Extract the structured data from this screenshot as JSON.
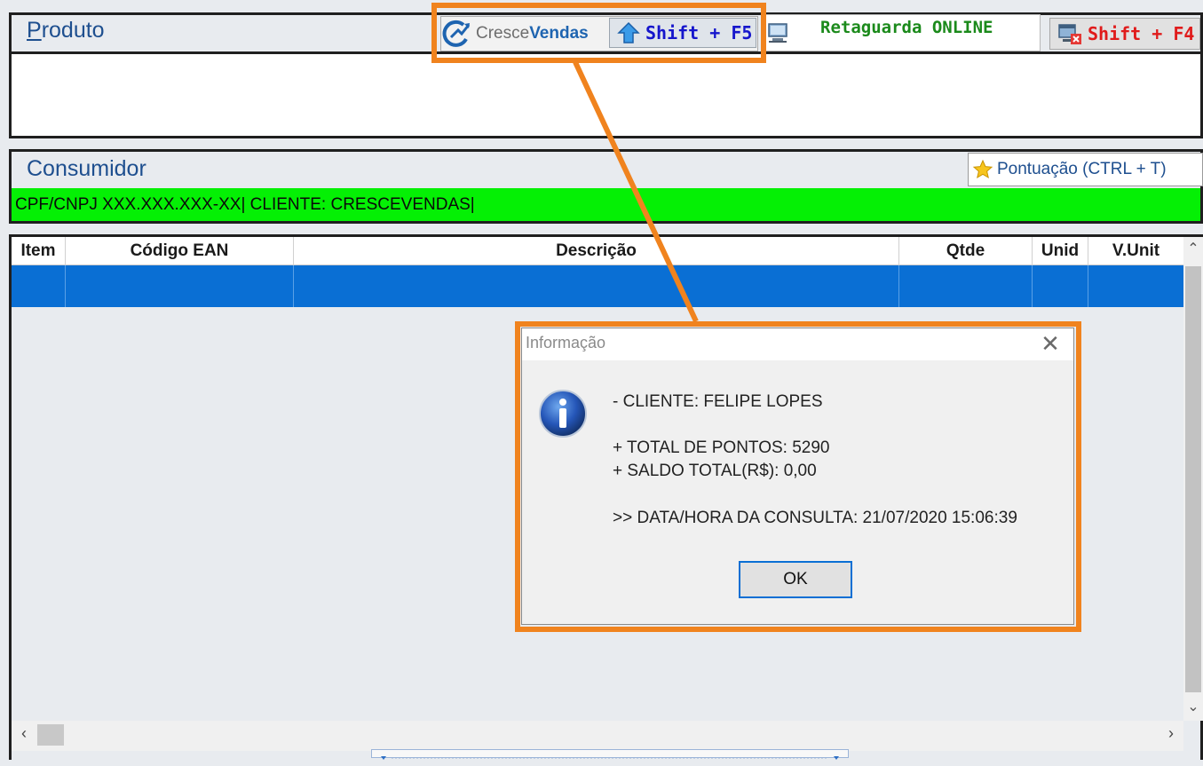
{
  "produto": {
    "title_underlined": "P",
    "title_rest": "roduto"
  },
  "toolbar": {
    "cresce_part1": "Cresce",
    "cresce_part2": "Vendas",
    "shift_f5": "Shift + F5",
    "retaguarda": "Retaguarda ONLINE",
    "shift_f4": "Shift + F4"
  },
  "consumidor": {
    "title": "Consumidor",
    "pontuacao_button": "Pontuação (CTRL + T)",
    "cliente_info": "CPF/CNPJ XXX.XXX.XXX-XX| CLIENTE: CRESCEVENDAS|"
  },
  "grid": {
    "columns": [
      "Item",
      "Código EAN",
      "Descrição",
      "Qtde",
      "Unid",
      "V.Unit"
    ],
    "selected_row_color": "#0a6fd4"
  },
  "dialog": {
    "title": "Informação",
    "lines": [
      "- CLIENTE: FELIPE LOPES",
      "+ TOTAL DE PONTOS: 5290",
      "+ SALDO TOTAL(R$): 0,00",
      ">> DATA/HORA DA CONSULTA: 21/07/2020 15:06:39"
    ],
    "ok_label": "OK"
  },
  "colors": {
    "callout": "#f0831e",
    "cliente_bar": "#05f005",
    "retaguarda_text": "#1b8a1b",
    "shift_f4_text": "#e01b1b",
    "shift_f5_text": "#1515cc"
  },
  "icons": [
    "cresce-vendas-logo-icon",
    "up-arrow-icon",
    "computer-icon",
    "window-close-icon",
    "star-icon",
    "information-icon"
  ]
}
